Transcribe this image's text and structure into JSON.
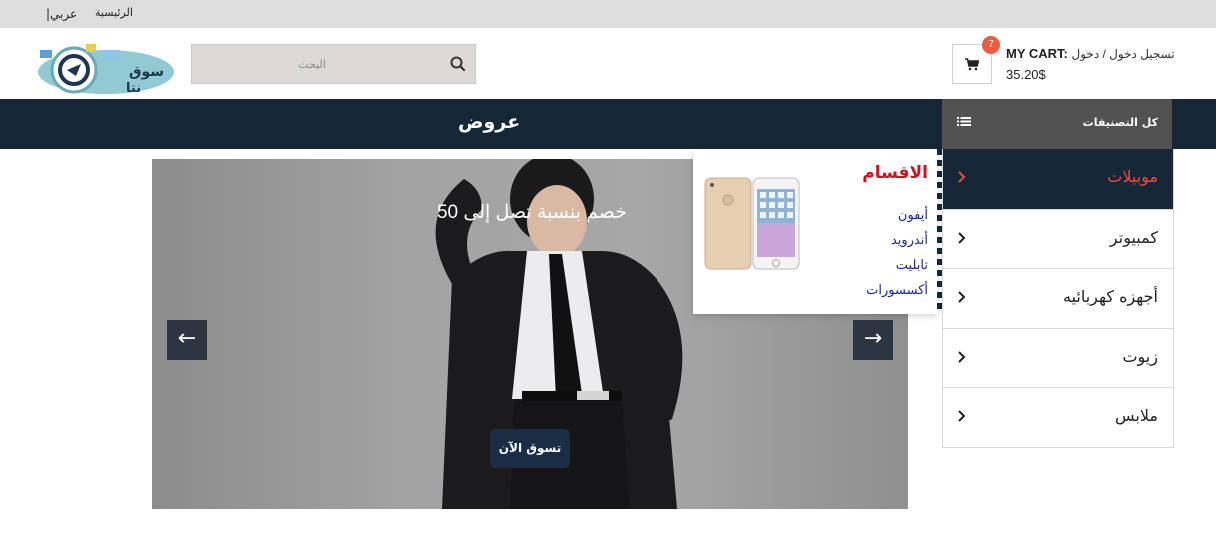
{
  "topbar": {
    "language_link": "|عربي",
    "home_link": "الرئيسية"
  },
  "search": {
    "placeholder": "البحث",
    "icon": "search-icon"
  },
  "cart": {
    "badge_count": "7",
    "label": "MY CART:",
    "login_text": "تسجيل دخول / دخول",
    "total": "35.20$",
    "icon": "shopping-cart-icon"
  },
  "navbar": {
    "offers_label": "عروض",
    "all_categories_label": "كل التصنيفات",
    "all_categories_icon": "list-icon"
  },
  "categories": [
    {
      "label": "موبيلات",
      "active": true
    },
    {
      "label": "كمبيوتر",
      "active": false
    },
    {
      "label": "أجهزه كهربائيه",
      "active": false
    },
    {
      "label": "زيوت",
      "active": false
    },
    {
      "label": "ملابس",
      "active": false
    }
  ],
  "submenu": {
    "title": "الاقسام",
    "links": [
      "أيفون",
      "أندرويد",
      "تابليت",
      "أكسسورات"
    ]
  },
  "hero": {
    "caption": "خصم بنسبة تصل إلى 50",
    "cta": "تسوق الآن",
    "prev_arrow": "←",
    "next_arrow": "→"
  },
  "colors": {
    "navbar_bg": "#152636",
    "active_category_text": "#ef4b3e",
    "submenu_title": "#d0101e",
    "badge": "#f05a40"
  }
}
